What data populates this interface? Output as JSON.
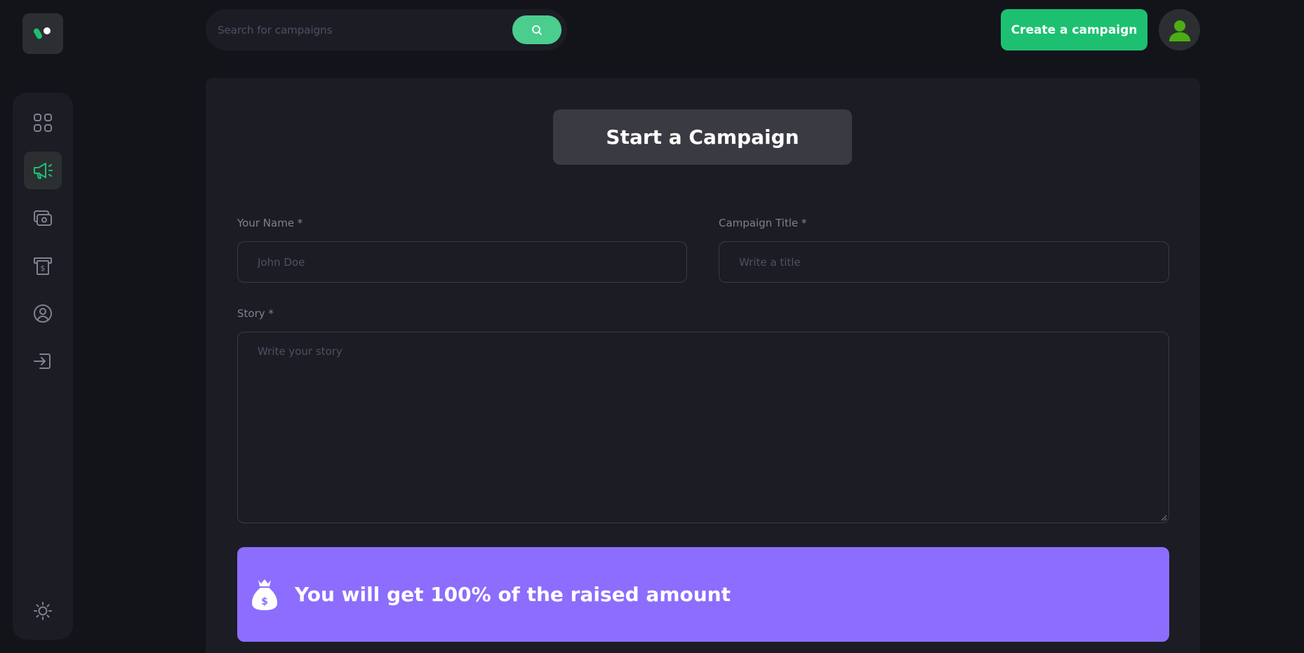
{
  "header": {
    "search": {
      "placeholder": "Search for campaigns"
    },
    "create_button_label": "Create a campaign"
  },
  "sidebar": {
    "items": [
      {
        "name": "dashboard",
        "icon": "grid-icon",
        "active": false
      },
      {
        "name": "campaign",
        "icon": "megaphone-icon",
        "active": true
      },
      {
        "name": "payment",
        "icon": "payment-icon",
        "active": false
      },
      {
        "name": "withdraw",
        "icon": "withdraw-icon",
        "active": false
      },
      {
        "name": "profile",
        "icon": "profile-icon",
        "active": false
      },
      {
        "name": "logout",
        "icon": "logout-icon",
        "active": false
      }
    ],
    "theme_icon": "sun-icon"
  },
  "form": {
    "title": "Start a Campaign",
    "name_label": "Your Name *",
    "name_placeholder": "John Doe",
    "campaign_title_label": "Campaign Title *",
    "campaign_title_placeholder": "Write a title",
    "story_label": "Story *",
    "story_placeholder": "Write your story",
    "banner_text": "You will get 100% of the raised amount"
  },
  "colors": {
    "accent_green": "#1dc071",
    "search_green": "#4acd8d",
    "banner_purple": "#8c6dfd",
    "background": "#13131a",
    "panel": "#1c1c24"
  }
}
